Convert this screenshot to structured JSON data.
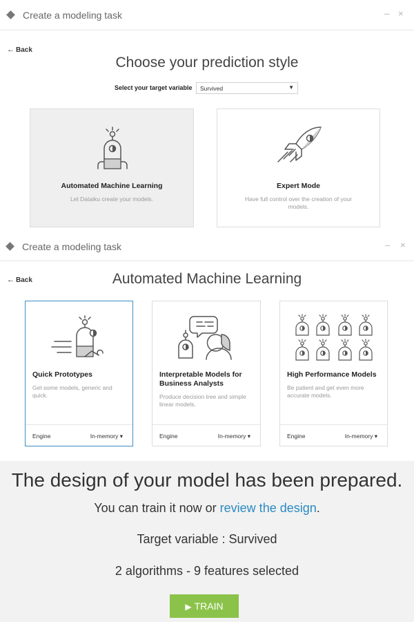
{
  "window1": {
    "title": "Create a modeling task",
    "back_label": "Back",
    "heading": "Choose your prediction style",
    "target_label": "Select your target variable",
    "target_value": "Survived",
    "cards": [
      {
        "title": "Automated Machine Learning",
        "desc": "Let Dataiku create your models.",
        "icon": "robot-icon"
      },
      {
        "title": "Expert Mode",
        "desc": "Have full control over the creation of your models.",
        "icon": "rocket-icon"
      }
    ]
  },
  "window2": {
    "title": "Create a modeling task",
    "back_label": "Back",
    "heading": "Automated Machine Learning",
    "cards": [
      {
        "title": "Quick Prototypes",
        "desc": "Get some models, generic and quick.",
        "engine_label": "Engine",
        "engine_value": "In-memory",
        "icon": "fast-robot-icon"
      },
      {
        "title": "Interpretable Models for Business Analysts",
        "desc": "Produce decision tree and simple linear models.",
        "engine_label": "Engine",
        "engine_value": "In-memory",
        "icon": "robot-human-chat-icon"
      },
      {
        "title": "High Performance Models",
        "desc": "Be patient and get even more accurate models.",
        "engine_label": "Engine",
        "engine_value": "In-memory",
        "icon": "robot-grid-icon"
      }
    ]
  },
  "summary": {
    "title": "The design of your model has been prepared.",
    "train_text_prefix": "You can train it now or ",
    "review_link": "review the design",
    "train_text_suffix": ".",
    "target_line": "Target variable : Survived",
    "algorithms_line": "2 algorithms - 9 features selected",
    "train_button": "TRAIN"
  },
  "colors": {
    "accent_link": "#2a8ac2",
    "train_green": "#8bc34a",
    "selected_border": "#3c8dc5"
  }
}
